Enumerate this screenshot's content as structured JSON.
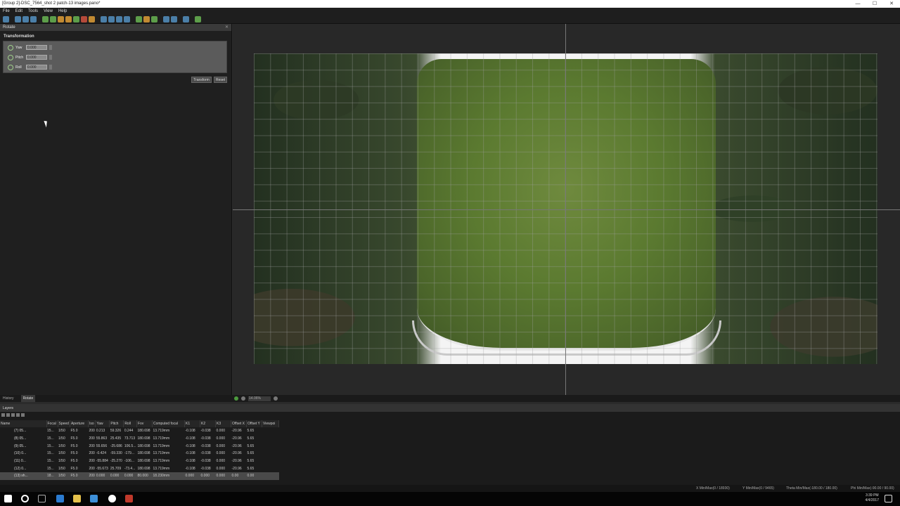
{
  "window": {
    "title": "[Group 2]-DSC_7564_shot 2 patch-13 images.pano*",
    "controls": [
      "—",
      "☐",
      "✕"
    ]
  },
  "menu": [
    "File",
    "Edit",
    "Tools",
    "View",
    "Help"
  ],
  "left_panel": {
    "title": "Rotate",
    "section": "Transformation",
    "fields": [
      {
        "label": "Yaw",
        "value": "0.000"
      },
      {
        "label": "Pitch",
        "value": "0.000"
      },
      {
        "label": "Roll",
        "value": "0.000"
      }
    ],
    "buttons": {
      "transform": "Transform",
      "reset": "Reset"
    },
    "tabs": [
      "History",
      "Rotate"
    ]
  },
  "viewport": {
    "zoom": "14.06%"
  },
  "layers": {
    "title": "Layers",
    "columns": [
      "Name",
      "Focal",
      "Speed",
      "Aperture",
      "Iso",
      "Yaw",
      "Pitch",
      "Roll",
      "Fov",
      "Computed focal",
      "K1",
      "K2",
      "K3",
      "Offset X",
      "Offset Y",
      "Viewpoi"
    ],
    "rows": [
      [
        "(7) 05...",
        "15...",
        "1/50",
        "F5.0",
        "200",
        "0.213",
        "59.326",
        "0.244",
        "180.698",
        "13.719mm",
        "-0.108",
        "-0.038",
        "0.000",
        "-20.96",
        "5.65",
        ""
      ],
      [
        "(8) 05...",
        "15...",
        "1/50",
        "F5.0",
        "200",
        "55.863",
        "25.435",
        "73.713",
        "180.698",
        "13.719mm",
        "-0.108",
        "-0.038",
        "0.000",
        "-20.96",
        "5.65",
        ""
      ],
      [
        "(9) 05...",
        "15...",
        "1/50",
        "F5.0",
        "200",
        "55.656",
        "-25.686",
        "106.5...",
        "180.698",
        "13.719mm",
        "-0.108",
        "-0.038",
        "0.000",
        "-20.96",
        "5.65",
        ""
      ],
      [
        "(10) 0...",
        "15...",
        "1/50",
        "F5.0",
        "200",
        "-0.424",
        "-59.330",
        "-179...",
        "180.698",
        "13.719mm",
        "-0.108",
        "-0.038",
        "0.000",
        "-20.96",
        "5.65",
        ""
      ],
      [
        "(11) 0...",
        "15...",
        "1/50",
        "F5.0",
        "200",
        "-55.884",
        "-25.270",
        "-106...",
        "180.698",
        "13.719mm",
        "-0.108",
        "-0.038",
        "0.000",
        "-20.96",
        "5.65",
        ""
      ],
      [
        "(12) 0...",
        "15...",
        "1/50",
        "F5.0",
        "200",
        "-55.673",
        "25.709",
        "-73.4...",
        "180.698",
        "13.719mm",
        "-0.108",
        "-0.038",
        "0.000",
        "-20.96",
        "5.65",
        ""
      ],
      [
        "(13) sh...",
        "18...",
        "1/50",
        "F5.0",
        "200",
        "0.000",
        "0.000",
        "0.000",
        "80.000",
        "18.230mm",
        "0.000",
        "0.000",
        "0.000",
        "0.00",
        "0.00",
        ""
      ]
    ]
  },
  "coords": {
    "x": "X Min/Max(0 / 18930)",
    "y": "Y Min/Max(0 / 9465)",
    "theta": "Theta Min/Max(-180.00 / 180.00)",
    "phi": "Phi Min/Max(-90.00 / 90.00)"
  },
  "clock": {
    "time": "3:39 PM",
    "date": "4/4/2017"
  }
}
